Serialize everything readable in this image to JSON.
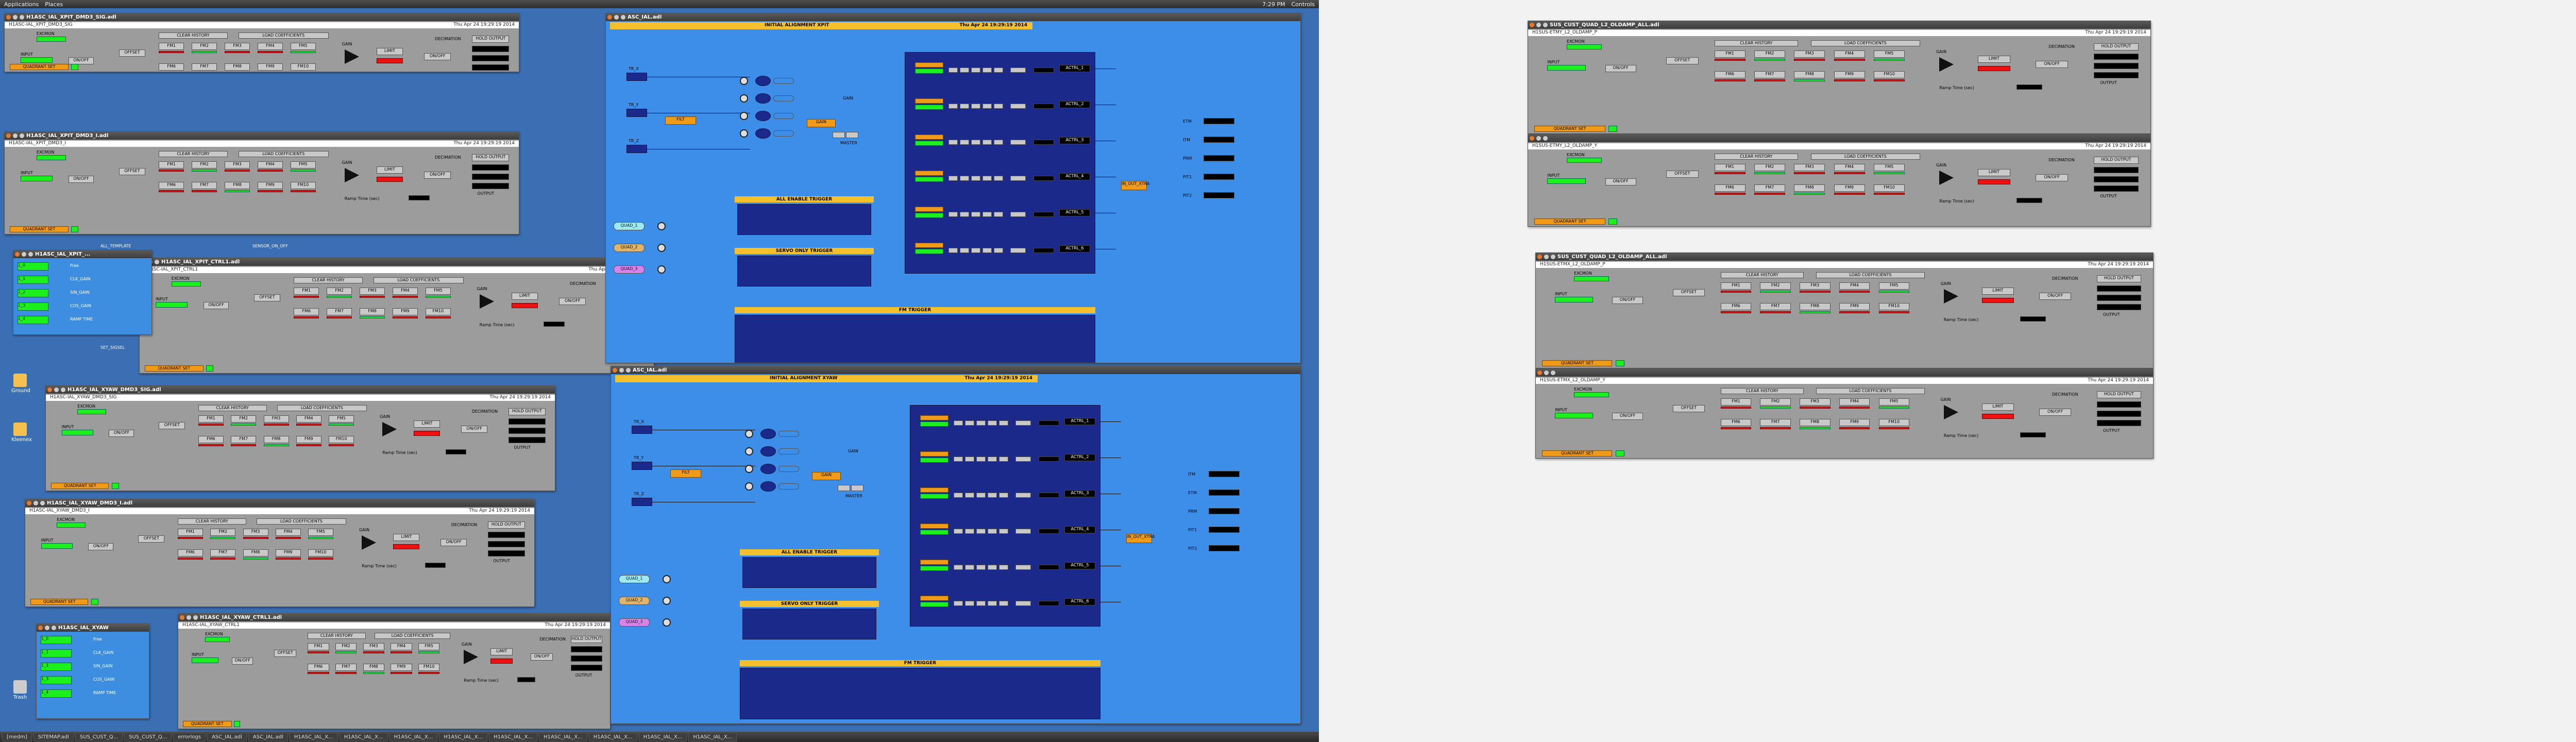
{
  "top_panel": {
    "menu_apps": "Applications",
    "menu_places": "Places",
    "clock": "7:29 PM",
    "user": "Controls"
  },
  "filter_windows": [
    {
      "title": "H1ASC_IAL_XPIT_DMD3_SIG.adl",
      "subtitle": "H1ASC-IAL_XPIT_DMD3_SIG",
      "date": "Thu Apr 24 19:29:19 2014"
    },
    {
      "title": "H1ASC_IAL_XPIT_DMD3_I.adl",
      "subtitle": "H1ASC-IAL_XPIT_DMD3_I",
      "date": "Thu Apr 24 19:29:19 2014"
    },
    {
      "title": "H1ASC_IAL_XPIT_CTRL1.adl",
      "subtitle": "H1ASC-IAL_XPIT_CTRL1",
      "date": "Thu Apr 24 19:29:19 2014",
      "note": "FILTER MODULE w/Control"
    },
    {
      "title": "H1ASC_IAL_XYAW_DMD3_SIG.adl",
      "subtitle": "H1ASC-IAL_XYAW_DMD3_SIG",
      "date": "Thu Apr 24 19:29:19 2014"
    },
    {
      "title": "H1ASC_IAL_XYAW_DMD3_I.adl",
      "subtitle": "H1ASC-IAL_XYAW_DMD3_I",
      "date": "Thu Apr 24 19:29:19 2014"
    },
    {
      "title": "H1ASC_IAL_XYAW_CTRL1.adl",
      "subtitle": "H1ASC-IAL_XYAW_CTRL1",
      "date": "Thu Apr 24 19:29:19 2014",
      "note": "FILTER MODULE w/Control"
    },
    {
      "title": "SUS_CUST_QUAD_L2_OLDAMP_ALL.adl",
      "subtitle": "H1SUS-ETMY_L2_OLDAMP_P",
      "date": "Thu Apr 24 19:29:19 2014"
    },
    {
      "title": "",
      "subtitle": "H1SUS-ETMY_L2_OLDAMP_Y",
      "date": "Thu Apr 24 19:29:19 2014"
    },
    {
      "title": "SUS_CUST_QUAD_L2_OLDAMP_ALL.adl",
      "subtitle": "H1SUS-ETMX_L2_OLDAMP_P",
      "date": "Thu Apr 24 19:29:19 2014"
    },
    {
      "title": "",
      "subtitle": "H1SUS-ETMX_L2_OLDAMP_Y",
      "date": "Thu Apr 24 19:29:19 2014"
    }
  ],
  "filter_labels": {
    "excmon": "EXCMON",
    "input": "INPUT",
    "offset": "OFFSET",
    "clear_history": "CLEAR HISTORY",
    "load_coeff": "LOAD COEFFICIENTS",
    "limit": "LIMIT",
    "onoff": "ON/OFF",
    "decimation": "DECIMATION",
    "hold_output": "HOLD OUTPUT",
    "output": "OUTPUT",
    "quadrant_set": "QUADRANT SET",
    "gain": "GAIN",
    "ramp_time": "Ramp Time (sec)",
    "outmon": "OUTMON",
    "fm": [
      "FM1",
      "FM2",
      "FM3",
      "FM4",
      "FM5",
      "FM6",
      "FM7",
      "FM8",
      "FM9",
      "FM10"
    ],
    "current_state": "Current State",
    "state_xx": "State XX"
  },
  "mini_windows": [
    {
      "title": "H1ASC_IAL_XPIT_...",
      "rows": [
        "1_0",
        "1_1",
        "1_2",
        "1_3",
        "1_4"
      ],
      "col_labels": [
        "Free",
        "CLK_GAIN",
        "SIN_GAIN",
        "COS_GAIN",
        "RAMP TIME"
      ]
    },
    {
      "title": "H1ASC_IAL_XYAW",
      "rows": [
        "1_0",
        "1_1",
        "1_2",
        "1_3",
        "1_4"
      ],
      "col_labels": [
        "Free",
        "CLK_GAIN",
        "SIN_GAIN",
        "COS_GAIN",
        "RAMP TIME"
      ]
    }
  ],
  "asc_windows": [
    {
      "title": "ASC_IAL.adl",
      "header": "INITIAL ALIGNMENT XPIT",
      "date": "Thu Apr 24 19:29:19 2014",
      "inputs": [
        "TR_X",
        "TR_Y",
        "TR_Z"
      ],
      "right_outs": [
        "ETM",
        "ITM",
        "PRM",
        "PIT1",
        "PIT2"
      ],
      "rows": [
        "ACTRL_1",
        "ACTRL_2",
        "ACTRL_3",
        "ACTRL_4",
        "ACTRL_5",
        "ACTRL_6"
      ],
      "quad_labels": [
        "QUAD_1",
        "QUAD_2",
        "QUAD_3"
      ],
      "all_enable": "ALL ENABLE TRIGGER",
      "servo_only": "SERVO ONLY TRIGGER",
      "fm_trigger": "FM TRIGGER",
      "master": "MASTER",
      "gain": "GAIN",
      "filt": "FILT",
      "out_label": "IN_OUT_XTRA"
    },
    {
      "title": "ASC_IAL.adl",
      "header": "INITIAL ALIGNMENT XYAW",
      "date": "Thu Apr 24 19:29:19 2014",
      "inputs": [
        "TR_X",
        "TR_Y",
        "TR_Z"
      ],
      "right_outs": [
        "ITM",
        "ETM",
        "PRM",
        "PIT1",
        "PIT2"
      ],
      "rows": [
        "ACTRL_1",
        "ACTRL_2",
        "ACTRL_3",
        "ACTRL_4",
        "ACTRL_5",
        "ACTRL_6"
      ],
      "quad_labels": [
        "QUAD_1",
        "QUAD_2",
        "QUAD_3"
      ],
      "all_enable": "ALL ENABLE TRIGGER",
      "servo_only": "SERVO ONLY TRIGGER",
      "fm_trigger": "FM TRIGGER",
      "master": "MASTER",
      "gain": "GAIN",
      "filt": "FILT",
      "out_label": "IN_OUT_XTRA"
    }
  ],
  "desktop_icons": [
    "Ground",
    "Kleenex",
    "Trash"
  ],
  "desktop_labels": {
    "sensor_onoff": "SENSOR_ON_OFF",
    "all_template": "ALL_TEMPLATE",
    "set_sigsel": "SET_SIGSEL"
  },
  "taskbar": [
    "[medm]",
    "SITEMAP.adl",
    "SUS_CUST_Q...",
    "SUS_CUST_Q...",
    "errorlogs",
    "ASC_IAL.adl",
    "ASC_IAL.adl",
    "H1ASC_IAL_X...",
    "H1ASC_IAL_X...",
    "H1ASC_IAL_X...",
    "H1ASC_IAL_X...",
    "H1ASC_IAL_X...",
    "H1ASC_IAL_X...",
    "H1ASC_IAL_X...",
    "H1ASC_IAL_X...",
    "H1ASC_IAL_X..."
  ]
}
